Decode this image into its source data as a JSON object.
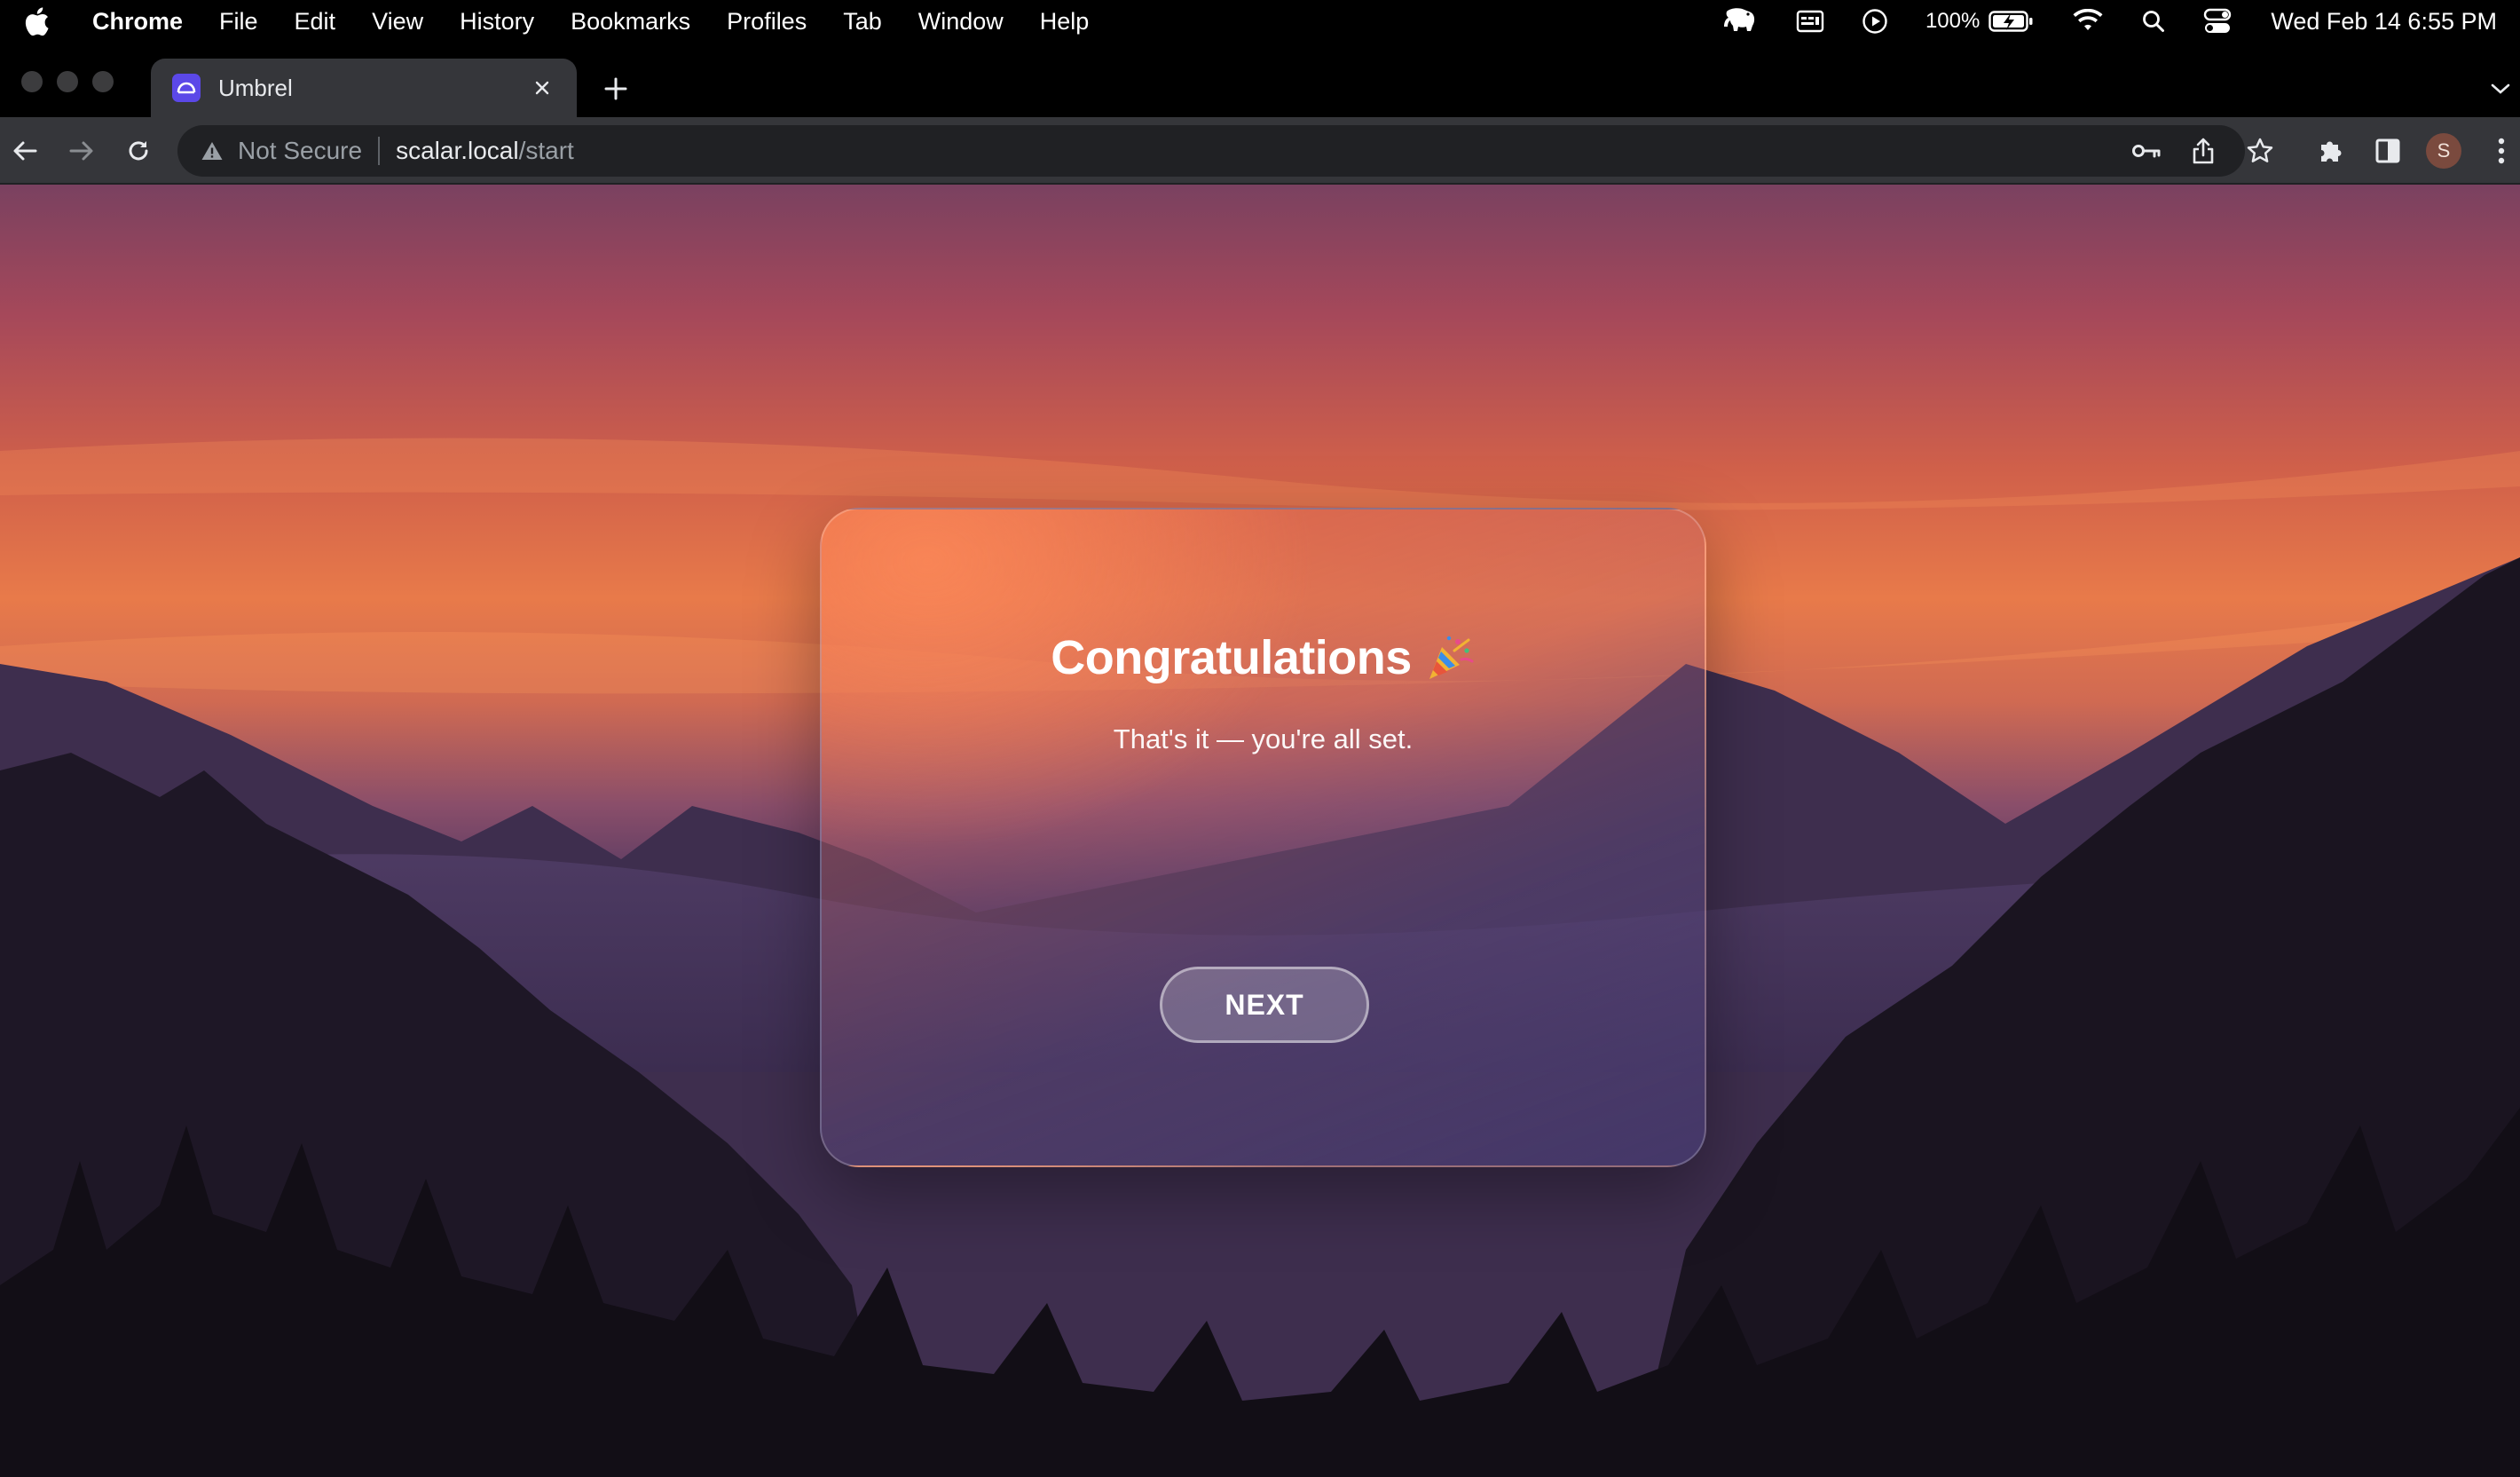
{
  "menubar": {
    "app_name": "Chrome",
    "items": [
      "File",
      "Edit",
      "View",
      "History",
      "Bookmarks",
      "Profiles",
      "Tab",
      "Window",
      "Help"
    ],
    "battery_percent": "100%",
    "clock": "Wed Feb 14  6:55 PM"
  },
  "browser": {
    "tab": {
      "title": "Umbrel"
    },
    "address": {
      "security_label": "Not Secure",
      "host": "scalar.local",
      "path": "/start"
    },
    "profile_initial": "S"
  },
  "card": {
    "title": "Congratulations",
    "subtitle": "That's it — you're all set.",
    "button_label": "NEXT"
  },
  "colors": {
    "accent_favicon": "#5b48e8",
    "toolbar_bg": "#35363a",
    "omnibox_bg": "#202124"
  }
}
